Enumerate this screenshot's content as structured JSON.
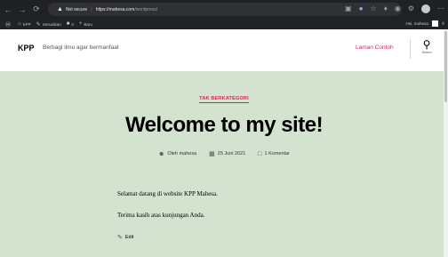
{
  "browser": {
    "back_icon": "arrow-left-icon",
    "forward_icon": "arrow-right-icon",
    "reload_icon": "reload-icon",
    "security_label": "Not secure",
    "url_host": "https://mahesa.com",
    "url_path": "/wordpress/",
    "accent_color": "#8ab4f8"
  },
  "admin_bar": {
    "site_name": "KPP",
    "customize_label": "Sesuaikan",
    "comments_count": "0",
    "new_label": "Baru",
    "greeting": "Hai, mahesa"
  },
  "header": {
    "site_title": "KPP",
    "tagline": "Berbagi ilmu agar bermanfaat",
    "menu_link": "Laman Contoh",
    "search_label": "Search"
  },
  "post": {
    "category": "TAK BERKATEGORI",
    "title": "Welcome to my site!",
    "author": "Oleh mahesa",
    "date": "25 Juni 2021",
    "comments": "1 Komentar",
    "paragraphs": [
      "Selamat datang di website KPP Mahesa.",
      "Terima kasih atas kunjungan Anda."
    ],
    "edit_label": "Edit"
  },
  "colors": {
    "accent": "#cd2653",
    "content_background": "#d4e3d0",
    "admin_bar": "#1d2327"
  }
}
